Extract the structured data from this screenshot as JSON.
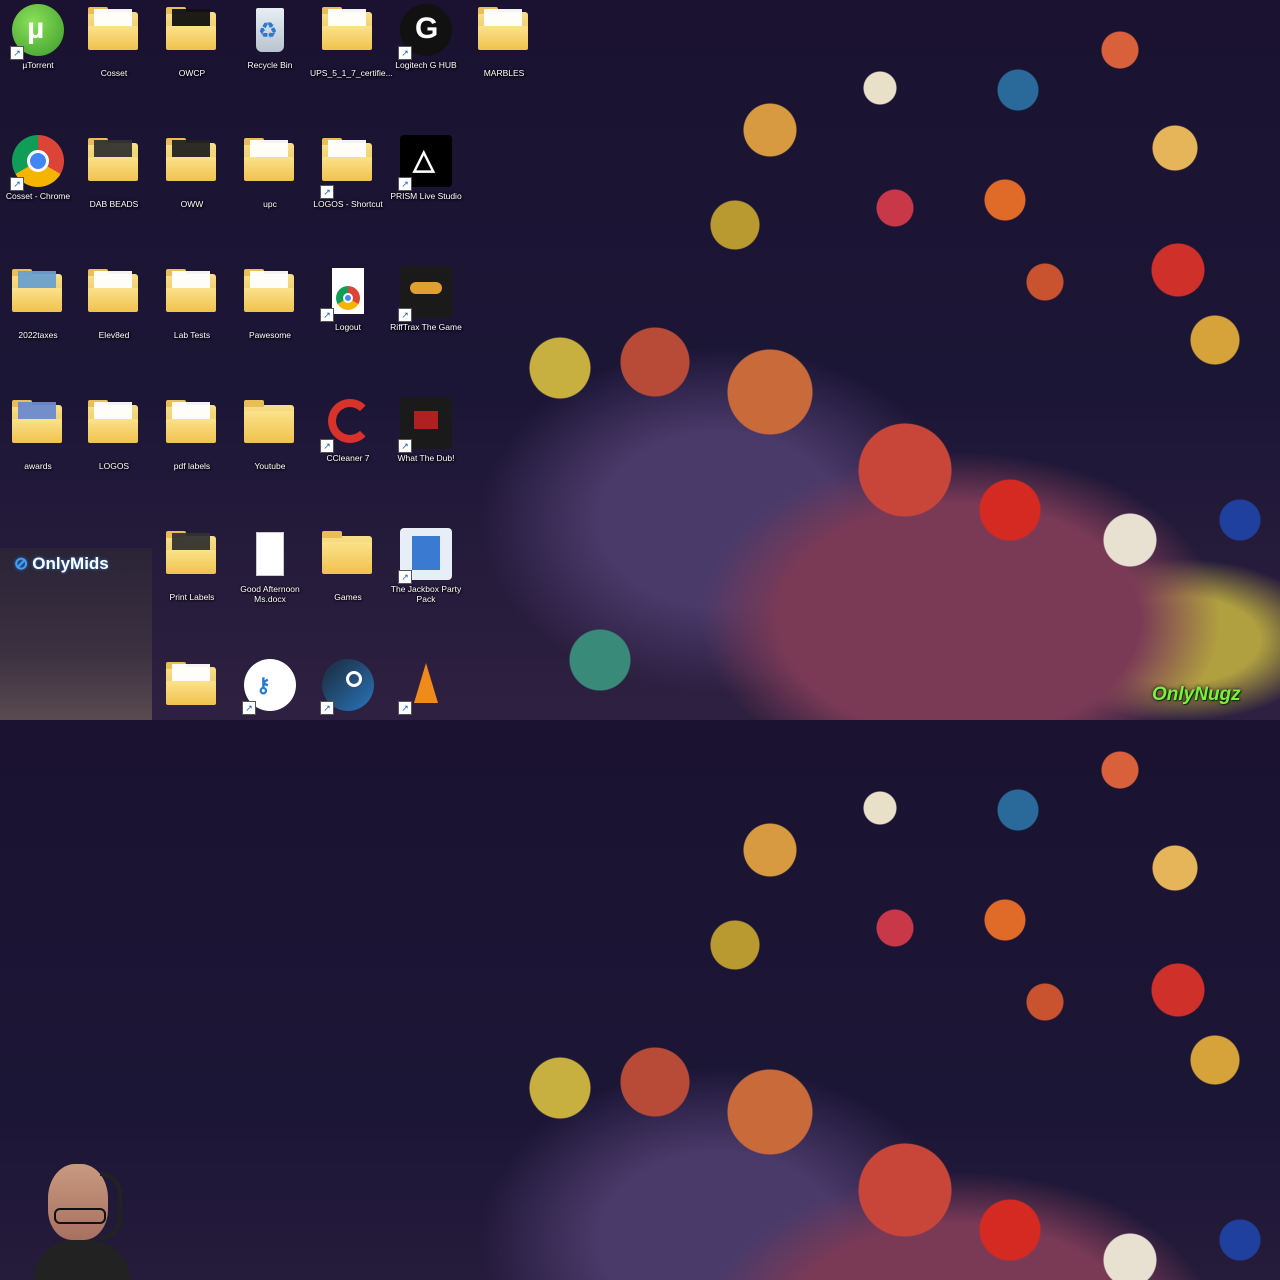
{
  "desktop": {
    "icons": [
      {
        "label": "µTorrent",
        "type": "app",
        "icon": "utorrent-icon"
      },
      {
        "label": "Cosset",
        "type": "folder"
      },
      {
        "label": "OWCP",
        "type": "folder"
      },
      {
        "label": "Recycle Bin",
        "type": "app",
        "icon": "recycle-bin-icon"
      },
      {
        "label": "UPS_5_1_7_certifie...",
        "type": "folder"
      },
      {
        "label": "Logitech G HUB",
        "type": "app",
        "icon": "logitech-g-icon"
      },
      {
        "label": "MARBLES",
        "type": "folder"
      },
      {
        "label": "Cosset - Chrome",
        "type": "app",
        "icon": "chrome-icon"
      },
      {
        "label": "DAB BEADS",
        "type": "folder"
      },
      {
        "label": "OWW",
        "type": "folder"
      },
      {
        "label": "upc",
        "type": "folder"
      },
      {
        "label": "LOGOS - Shortcut",
        "type": "folder"
      },
      {
        "label": "PRISM Live Studio",
        "type": "app",
        "icon": "prism-icon"
      },
      {
        "label": "2022taxes",
        "type": "folder"
      },
      {
        "label": "Elev8ed",
        "type": "folder"
      },
      {
        "label": "Lab Tests",
        "type": "folder"
      },
      {
        "label": "Pawesome",
        "type": "folder"
      },
      {
        "label": "Logout",
        "type": "app",
        "icon": "chrome-doc-icon"
      },
      {
        "label": "RiffTrax The Game",
        "type": "app",
        "icon": "rifftrax-icon"
      },
      {
        "label": "awards",
        "type": "folder"
      },
      {
        "label": "LOGOS",
        "type": "folder"
      },
      {
        "label": "pdf labels",
        "type": "folder"
      },
      {
        "label": "Youtube",
        "type": "folder"
      },
      {
        "label": "CCleaner 7",
        "type": "app",
        "icon": "ccleaner-icon"
      },
      {
        "label": "What The Dub!",
        "type": "app",
        "icon": "whatthedub-icon"
      },
      {
        "label": "Print Labels",
        "type": "folder"
      },
      {
        "label": "Good Afternoon Ms.docx",
        "type": "file",
        "icon": "document-icon"
      },
      {
        "label": "Games",
        "type": "folder"
      },
      {
        "label": "The Jackbox Party Pack",
        "type": "app",
        "icon": "jackbox-icon"
      }
    ],
    "bottom_icons": [
      "folder-icon",
      "key-app-icon",
      "steam-icon",
      "vlc-icon"
    ]
  },
  "stream_overlay": {
    "webcam_banner": "OnlyMids",
    "brand_watermark": "OnlyNugz"
  }
}
